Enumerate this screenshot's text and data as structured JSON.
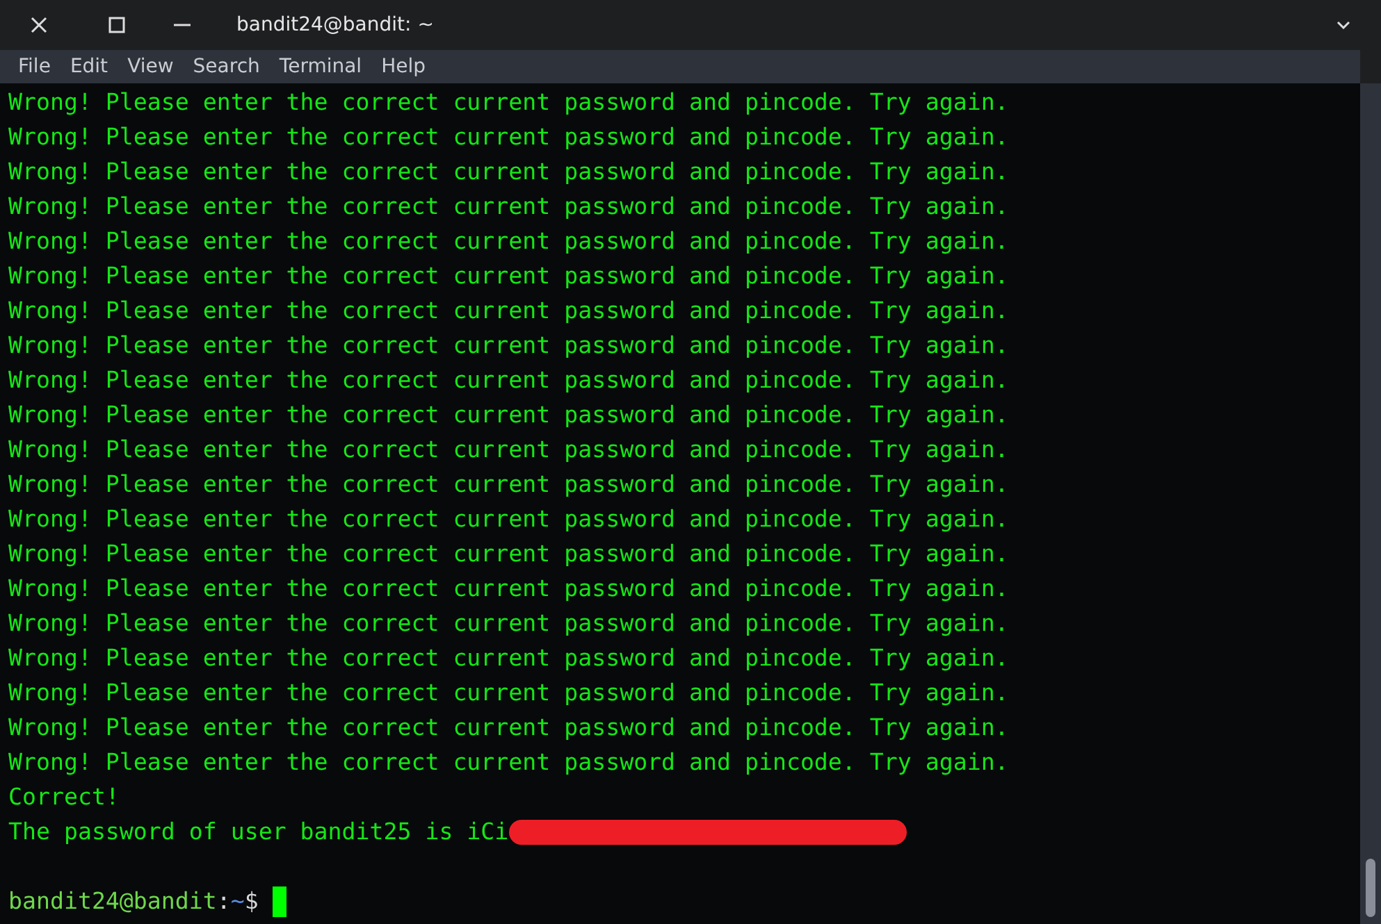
{
  "window": {
    "title": "bandit24@bandit: ~"
  },
  "menu": [
    "File",
    "Edit",
    "View",
    "Search",
    "Terminal",
    "Help"
  ],
  "output": [
    "Wrong! Please enter the correct current password and pincode. Try again.",
    "Wrong! Please enter the correct current password and pincode. Try again.",
    "Wrong! Please enter the correct current password and pincode. Try again.",
    "Wrong! Please enter the correct current password and pincode. Try again.",
    "Wrong! Please enter the correct current password and pincode. Try again.",
    "Wrong! Please enter the correct current password and pincode. Try again.",
    "Wrong! Please enter the correct current password and pincode. Try again.",
    "Wrong! Please enter the correct current password and pincode. Try again.",
    "Wrong! Please enter the correct current password and pincode. Try again.",
    "Wrong! Please enter the correct current password and pincode. Try again.",
    "Wrong! Please enter the correct current password and pincode. Try again.",
    "Wrong! Please enter the correct current password and pincode. Try again.",
    "Wrong! Please enter the correct current password and pincode. Try again.",
    "Wrong! Please enter the correct current password and pincode. Try again.",
    "Wrong! Please enter the correct current password and pincode. Try again.",
    "Wrong! Please enter the correct current password and pincode. Try again.",
    "Wrong! Please enter the correct current password and pincode. Try again.",
    "Wrong! Please enter the correct current password and pincode. Try again.",
    "Wrong! Please enter the correct current password and pincode. Try again.",
    "Wrong! Please enter the correct current password and pincode. Try again.",
    "Correct!"
  ],
  "password_line": {
    "text": "The password of user bandit25 is iCi",
    "redacted": true
  },
  "prompt": {
    "user_host": "bandit24@bandit",
    "separator": ":",
    "path": "~",
    "symbol": "$"
  }
}
